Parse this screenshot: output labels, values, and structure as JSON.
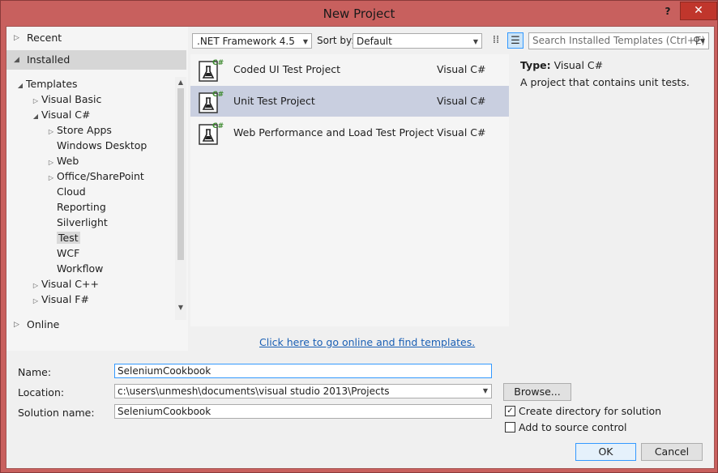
{
  "window": {
    "title": "New Project",
    "help": "?",
    "close": "✕"
  },
  "nav": {
    "recent": "Recent",
    "installed": "Installed",
    "online": "Online",
    "templates": "Templates",
    "tree": [
      {
        "label": "Visual Basic",
        "expander": "▷"
      },
      {
        "label": "Visual C#",
        "expander": "◢"
      },
      {
        "label": "Store Apps",
        "expander": "▷"
      },
      {
        "label": "Windows Desktop",
        "expander": ""
      },
      {
        "label": "Web",
        "expander": "▷"
      },
      {
        "label": "Office/SharePoint",
        "expander": "▷"
      },
      {
        "label": "Cloud",
        "expander": ""
      },
      {
        "label": "Reporting",
        "expander": ""
      },
      {
        "label": "Silverlight",
        "expander": ""
      },
      {
        "label": "Test",
        "expander": ""
      },
      {
        "label": "WCF",
        "expander": ""
      },
      {
        "label": "Workflow",
        "expander": ""
      },
      {
        "label": "Visual C++",
        "expander": "▷"
      },
      {
        "label": "Visual F#",
        "expander": "▷"
      }
    ]
  },
  "toolbar": {
    "framework": ".NET Framework 4.5",
    "sort_label": "Sort by:",
    "sort_value": "Default",
    "search_placeholder": "Search Installed Templates (Ctrl+E)"
  },
  "templates": [
    {
      "name": "Coded UI Test Project",
      "lang": "Visual C#"
    },
    {
      "name": "Unit Test Project",
      "lang": "Visual C#"
    },
    {
      "name": "Web Performance and Load Test Project",
      "lang": "Visual C#"
    }
  ],
  "details": {
    "type_label": "Type:",
    "type_value": "Visual C#",
    "description": "A project that contains unit tests."
  },
  "online_link": "Click here to go online and find templates.",
  "form": {
    "name_label": "Name:",
    "name_value": "SeleniumCookbook",
    "location_label": "Location:",
    "location_value": "c:\\users\\unmesh\\documents\\visual studio 2013\\Projects",
    "solution_label": "Solution name:",
    "solution_value": "SeleniumCookbook",
    "browse": "Browse...",
    "create_dir": "Create directory for solution",
    "create_dir_checked": true,
    "source_control": "Add to source control",
    "source_control_checked": false,
    "ok": "OK",
    "cancel": "Cancel"
  },
  "colors": {
    "title_bar": "#c8605e",
    "selected_row": "#c9cfe0",
    "link": "#1a5fb4"
  }
}
